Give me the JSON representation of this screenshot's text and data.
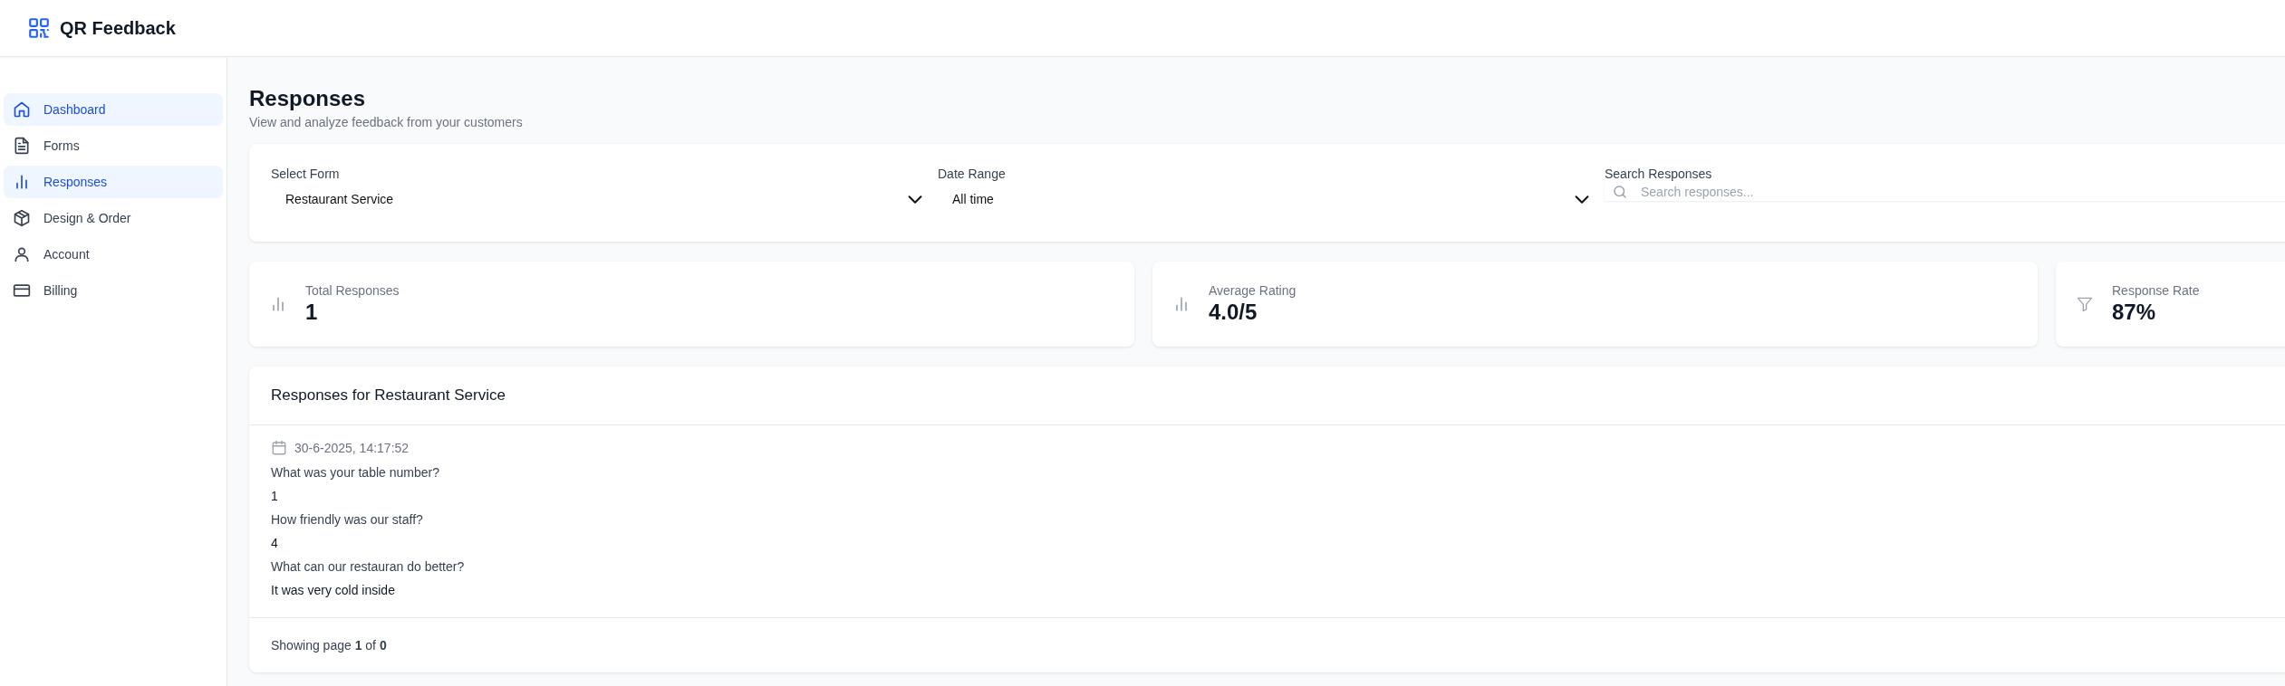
{
  "app": {
    "title": "QR Feedback"
  },
  "sidebar": {
    "items": [
      {
        "label": "Dashboard",
        "selected": true
      },
      {
        "label": "Forms",
        "selected": false
      },
      {
        "label": "Responses",
        "selected": true
      },
      {
        "label": "Design & Order",
        "selected": false
      },
      {
        "label": "Account",
        "selected": false
      },
      {
        "label": "Billing",
        "selected": false
      }
    ]
  },
  "page": {
    "title": "Responses",
    "subtitle": "View and analyze feedback from your customers"
  },
  "filters": [
    {
      "kind": "select",
      "label": "Select Form",
      "value": "Restaurant Service"
    },
    {
      "kind": "select",
      "label": "Date Range",
      "value": "All time"
    },
    {
      "kind": "search",
      "label": "Search Responses",
      "placeholder": "Search responses..."
    }
  ],
  "stats": [
    {
      "label": "Total Responses",
      "value": "1"
    },
    {
      "label": "Average Rating",
      "value": "4.0/5"
    },
    {
      "label": "Response Rate",
      "value": "87%"
    }
  ],
  "responses": {
    "title": "Responses for Restaurant Service",
    "items": [
      {
        "date": "30-6-2025, 14:17:52",
        "answers": [
          {
            "question": "What was your table number?",
            "answer": "1"
          },
          {
            "question": "How friendly was our staff?",
            "answer": "4"
          },
          {
            "question": "What can our restauran do better?",
            "answer": "It was very cold inside"
          }
        ]
      }
    ],
    "footer": "Showing page **1** of **0**"
  }
}
